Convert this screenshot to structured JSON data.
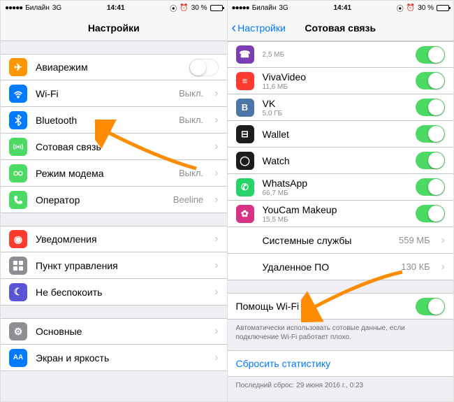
{
  "status": {
    "carrier": "Билайн",
    "network": "3G",
    "time": "14:41",
    "battery_pct": "30 %"
  },
  "left": {
    "title": "Настройки",
    "rows": {
      "airplane": "Авиарежим",
      "wifi": "Wi-Fi",
      "wifi_val": "Выкл.",
      "bluetooth": "Bluetooth",
      "bt_val": "Выкл.",
      "cellular": "Сотовая связь",
      "hotspot": "Режим модема",
      "hotspot_val": "Выкл.",
      "carrier": "Оператор",
      "carrier_val": "Beeline",
      "notifications": "Уведомления",
      "control": "Пункт управления",
      "dnd": "Не беспокоить",
      "general": "Основные",
      "display": "Экран и яркость"
    }
  },
  "right": {
    "back": "Настройки",
    "title": "Сотовая связь",
    "apps": [
      {
        "name": "",
        "size": "2,5 МБ",
        "icon_bg": "#7b3fb3",
        "icon_txt": "☎"
      },
      {
        "name": "VivaVideo",
        "size": "11,6 МБ",
        "icon_bg": "#ff3b30",
        "icon_txt": "≡"
      },
      {
        "name": "VK",
        "size": "5,0 ГБ",
        "icon_bg": "#4a76a8",
        "icon_txt": "B"
      },
      {
        "name": "Wallet",
        "size": "",
        "icon_bg": "#1c1c1e",
        "icon_txt": "⊟"
      },
      {
        "name": "Watch",
        "size": "",
        "icon_bg": "#1c1c1e",
        "icon_txt": "◯"
      },
      {
        "name": "WhatsApp",
        "size": "66,7 МБ",
        "icon_bg": "#25d366",
        "icon_txt": "✆"
      },
      {
        "name": "YouCam Makeup",
        "size": "15,5 МБ",
        "icon_bg": "#d63384",
        "icon_txt": "✿"
      }
    ],
    "system_services": "Системные службы",
    "system_services_val": "559 МБ",
    "deleted": "Удаленное ПО",
    "deleted_val": "130 КБ",
    "wifi_assist": "Помощь Wi-Fi",
    "wifi_assist_desc": "Автоматически использовать сотовые данные, если подключение Wi-Fi работает плохо.",
    "reset": "Сбросить статистику",
    "last_reset": "Последний сброс: 29 июня 2016 г., 0:23"
  }
}
